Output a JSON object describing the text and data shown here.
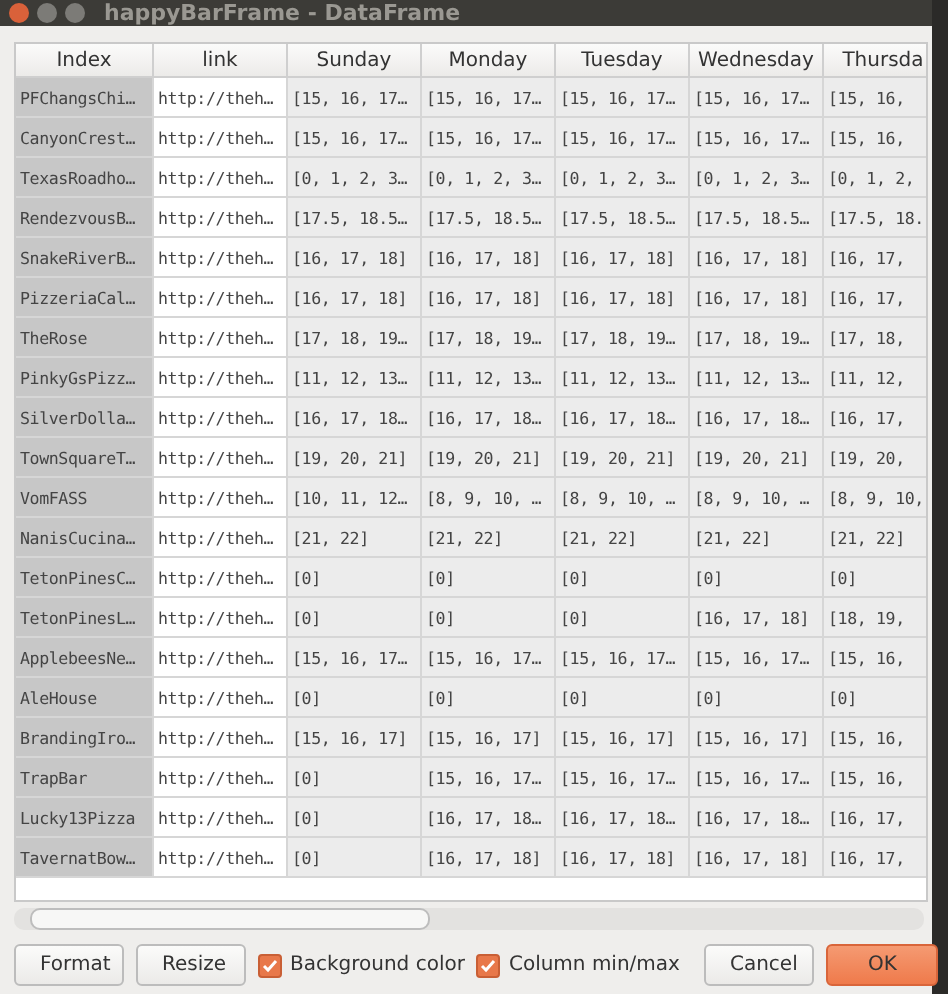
{
  "window": {
    "title": "happyBarFrame - DataFrame"
  },
  "table": {
    "columns": [
      "Index",
      "link",
      "Sunday",
      "Monday",
      "Tuesday",
      "Wednesday",
      "Thursda"
    ],
    "rows": [
      {
        "cells": [
          "PFChangsChi…",
          "http://theh…",
          "[15, 16, 17…",
          "[15, 16, 17…",
          "[15, 16, 17…",
          "[15, 16, 17…",
          "[15, 16,"
        ]
      },
      {
        "cells": [
          "CanyonCrest…",
          "http://theh…",
          "[15, 16, 17…",
          "[15, 16, 17…",
          "[15, 16, 17…",
          "[15, 16, 17…",
          "[15, 16,"
        ]
      },
      {
        "cells": [
          "TexasRoadho…",
          "http://theh…",
          "[0, 1, 2, 3…",
          "[0, 1, 2, 3…",
          "[0, 1, 2, 3…",
          "[0, 1, 2, 3…",
          "[0, 1, 2,"
        ]
      },
      {
        "cells": [
          "RendezvousB…",
          "http://theh…",
          "[17.5, 18.5…",
          "[17.5, 18.5…",
          "[17.5, 18.5…",
          "[17.5, 18.5…",
          "[17.5, 18."
        ]
      },
      {
        "cells": [
          "SnakeRiverB…",
          "http://theh…",
          "[16, 17, 18]",
          "[16, 17, 18]",
          "[16, 17, 18]",
          "[16, 17, 18]",
          "[16, 17,"
        ]
      },
      {
        "cells": [
          "PizzeriaCal…",
          "http://theh…",
          "[16, 17, 18]",
          "[16, 17, 18]",
          "[16, 17, 18]",
          "[16, 17, 18]",
          "[16, 17,"
        ]
      },
      {
        "cells": [
          "TheRose",
          "http://theh…",
          "[17, 18, 19…",
          "[17, 18, 19…",
          "[17, 18, 19…",
          "[17, 18, 19…",
          "[17, 18,"
        ]
      },
      {
        "cells": [
          "PinkyGsPizz…",
          "http://theh…",
          "[11, 12, 13…",
          "[11, 12, 13…",
          "[11, 12, 13…",
          "[11, 12, 13…",
          "[11, 12,"
        ]
      },
      {
        "cells": [
          "SilverDolla…",
          "http://theh…",
          "[16, 17, 18…",
          "[16, 17, 18…",
          "[16, 17, 18…",
          "[16, 17, 18…",
          "[16, 17,"
        ]
      },
      {
        "cells": [
          "TownSquareT…",
          "http://theh…",
          "[19, 20, 21]",
          "[19, 20, 21]",
          "[19, 20, 21]",
          "[19, 20, 21]",
          "[19, 20,"
        ]
      },
      {
        "cells": [
          "VomFASS",
          "http://theh…",
          "[10, 11, 12…",
          "[8, 9, 10, …",
          "[8, 9, 10, …",
          "[8, 9, 10, …",
          "[8, 9, 10,"
        ]
      },
      {
        "cells": [
          "NanisCucina…",
          "http://theh…",
          "[21, 22]",
          "[21, 22]",
          "[21, 22]",
          "[21, 22]",
          "[21, 22]"
        ]
      },
      {
        "cells": [
          "TetonPinesC…",
          "http://theh…",
          "[0]",
          "[0]",
          "[0]",
          "[0]",
          "[0]"
        ]
      },
      {
        "cells": [
          "TetonPinesL…",
          "http://theh…",
          "[0]",
          "[0]",
          "[0]",
          "[16, 17, 18]",
          "[18, 19,"
        ]
      },
      {
        "cells": [
          "ApplebeesNe…",
          "http://theh…",
          "[15, 16, 17…",
          "[15, 16, 17…",
          "[15, 16, 17…",
          "[15, 16, 17…",
          "[15, 16,"
        ]
      },
      {
        "cells": [
          "AleHouse",
          "http://theh…",
          "[0]",
          "[0]",
          "[0]",
          "[0]",
          "[0]"
        ]
      },
      {
        "cells": [
          "BrandingIro…",
          "http://theh…",
          "[15, 16, 17]",
          "[15, 16, 17]",
          "[15, 16, 17]",
          "[15, 16, 17]",
          "[15, 16,"
        ]
      },
      {
        "cells": [
          "TrapBar",
          "http://theh…",
          "[0]",
          "[15, 16, 17…",
          "[15, 16, 17…",
          "[15, 16, 17…",
          "[15, 16,"
        ]
      },
      {
        "cells": [
          "Lucky13Pizza",
          "http://theh…",
          "[0]",
          "[16, 17, 18…",
          "[16, 17, 18…",
          "[16, 17, 18…",
          "[16, 17,"
        ]
      },
      {
        "cells": [
          "TavernatBow…",
          "http://theh…",
          "[0]",
          "[16, 17, 18]",
          "[16, 17, 18]",
          "[16, 17, 18]",
          "[16, 17,"
        ]
      }
    ]
  },
  "footer": {
    "buttons": [
      "Format",
      "Resize"
    ],
    "checkboxes": [
      {
        "label": "Background color",
        "checked": true
      },
      {
        "label": "Column min/max",
        "checked": true
      }
    ],
    "actions": [
      {
        "label": "Cancel",
        "kind": "plain"
      },
      {
        "label": "OK",
        "kind": "primary"
      }
    ]
  }
}
